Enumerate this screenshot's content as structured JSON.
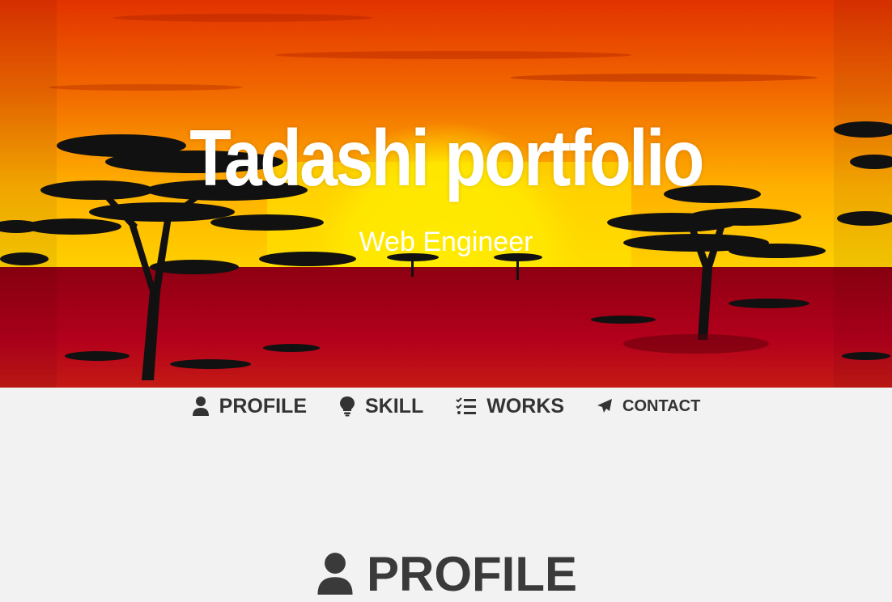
{
  "hero": {
    "title": "Tadashi portfolio",
    "subtitle": "Web Engineer"
  },
  "nav": {
    "items": [
      {
        "label": "PROFILE",
        "icon": "user-icon"
      },
      {
        "label": "SKILL",
        "icon": "lightbulb-icon"
      },
      {
        "label": "WORKS",
        "icon": "checklist-icon"
      },
      {
        "label": "CONTACT",
        "icon": "paper-plane-icon"
      }
    ]
  },
  "section": {
    "title": "PROFILE",
    "icon": "user-icon"
  },
  "colors": {
    "sky_top": "#e63a00",
    "sky_bottom": "#ffb300",
    "sun": "#ffe600",
    "ground": "#a5001a",
    "text_dark": "#333333",
    "page_bg": "#f2f2f2"
  }
}
